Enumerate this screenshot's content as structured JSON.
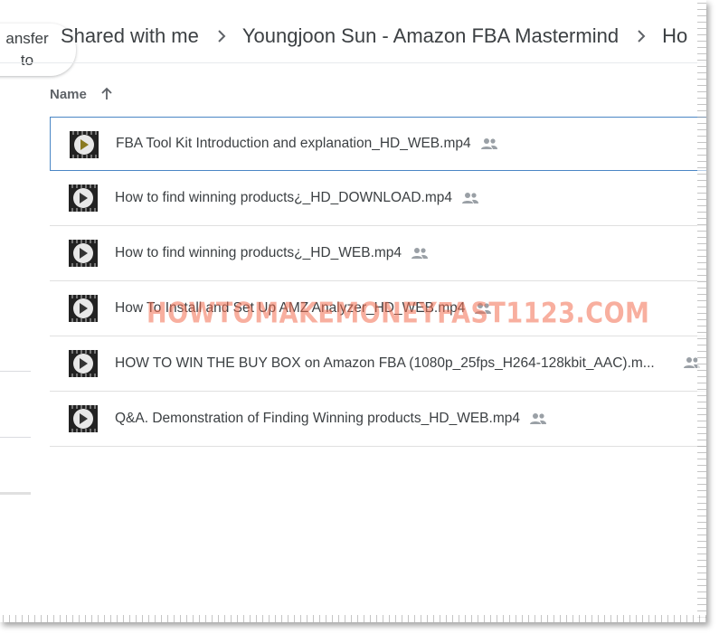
{
  "left_panel": {
    "transfer_line1": "ansfer",
    "transfer_line2": "to"
  },
  "breadcrumb": {
    "items": [
      "Shared with me",
      "Youngjoon Sun - Amazon FBA Mastermind",
      "Ho"
    ]
  },
  "list_header": {
    "name_label": "Name",
    "sort_icon": "arrow-up-icon"
  },
  "files": [
    {
      "name": "FBA Tool Kit Introduction and explanation_HD_WEB.mp4",
      "selected": true
    },
    {
      "name": "How to find winning products¿_HD_DOWNLOAD.mp4",
      "selected": false
    },
    {
      "name": "How to find winning products¿_HD_WEB.mp4",
      "selected": false
    },
    {
      "name": "How To Install and Set Up AMZ Analyzer_HD_WEB.mp4",
      "selected": false
    },
    {
      "name": "HOW TO WIN THE BUY BOX on Amazon FBA (1080p_25fps_H264-128kbit_AAC).m...",
      "selected": false
    },
    {
      "name": "Q&A. Demonstration of Finding Winning products_HD_WEB.mp4",
      "selected": false
    }
  ],
  "icons": {
    "file": "video-file-icon",
    "shared": "shared-people-icon"
  },
  "watermark": "HOWTOMAKEMONEYFAST1123.COM",
  "colors": {
    "selected_border": "#4a86c5",
    "watermark": "#f26e50",
    "text": "#3c4043"
  }
}
